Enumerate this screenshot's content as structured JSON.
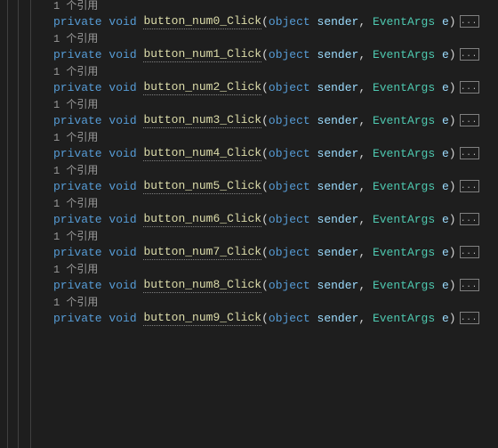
{
  "codelens_text": "1 个引用",
  "fold_placeholder": "...",
  "sig": {
    "private": "private",
    "void": "void",
    "object": "object",
    "sender": "sender",
    "eventargs": "EventArgs",
    "e": "e"
  },
  "methods": [
    {
      "name": "button_num0_Click",
      "cut": true
    },
    {
      "name": "button_num1_Click",
      "cut": false
    },
    {
      "name": "button_num2_Click",
      "cut": false
    },
    {
      "name": "button_num3_Click",
      "cut": false
    },
    {
      "name": "button_num4_Click",
      "cut": false
    },
    {
      "name": "button_num5_Click",
      "cut": false
    },
    {
      "name": "button_num6_Click",
      "cut": false
    },
    {
      "name": "button_num7_Click",
      "cut": false
    },
    {
      "name": "button_num8_Click",
      "cut": false
    },
    {
      "name": "button_num9_Click",
      "cut": false
    }
  ]
}
